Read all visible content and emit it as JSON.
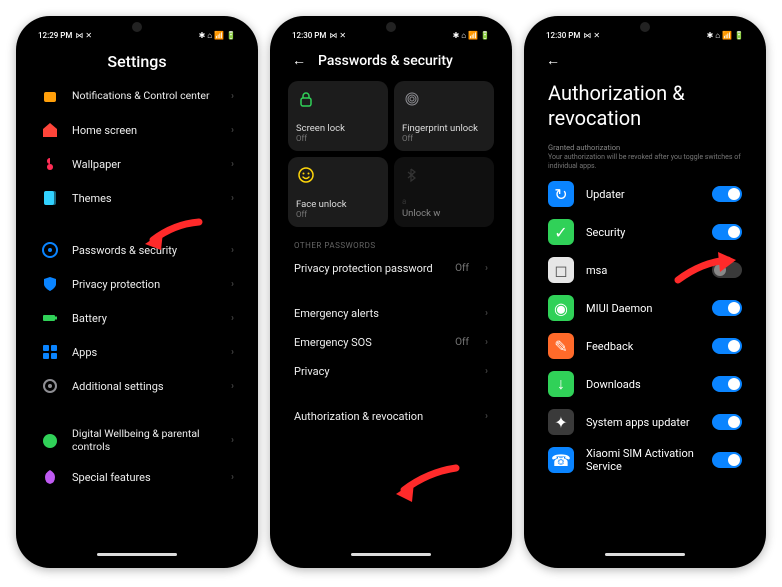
{
  "colors": {
    "accent_blue": "#0a84ff",
    "arrow_red": "#ff2a2a",
    "tile_bg": "#1c1c1c"
  },
  "screen1": {
    "status": {
      "time": "12:29 PM",
      "left_icons": "⋈ ✕",
      "right_icons": "✱ ⌂ 📶 🔋"
    },
    "title": "Settings",
    "items": [
      {
        "icon": "notifications-icon",
        "label": "Notifications & Control center",
        "color": "#ff9f0a"
      },
      {
        "icon": "home-icon",
        "label": "Home screen",
        "color": "#ff453a"
      },
      {
        "icon": "wallpaper-icon",
        "label": "Wallpaper",
        "color": "#ff2d55"
      },
      {
        "icon": "themes-icon",
        "label": "Themes",
        "color": "#32d2ff"
      }
    ],
    "items2": [
      {
        "icon": "lock-icon",
        "label": "Passwords & security",
        "color": "#0a84ff"
      },
      {
        "icon": "shield-icon",
        "label": "Privacy protection",
        "color": "#0a84ff"
      },
      {
        "icon": "battery-icon",
        "label": "Battery",
        "color": "#30d158"
      },
      {
        "icon": "apps-icon",
        "label": "Apps",
        "color": "#0a84ff"
      },
      {
        "icon": "gear-icon",
        "label": "Additional settings",
        "color": "#8e8e93"
      }
    ],
    "items3": [
      {
        "icon": "wellbeing-icon",
        "label": "Digital Wellbeing & parental controls",
        "color": "#30d158"
      },
      {
        "icon": "special-icon",
        "label": "Special features",
        "color": "#bf5af2"
      }
    ]
  },
  "screen2": {
    "status": {
      "time": "12:30 PM",
      "left_icons": "⋈ ✕",
      "right_icons": "✱ ⌂ 📶 🔋"
    },
    "title": "Passwords & security",
    "tiles": [
      {
        "icon": "padlock-icon",
        "title": "Screen lock",
        "sub": "Off",
        "color": "#30d158"
      },
      {
        "icon": "fingerprint-icon",
        "title": "Fingerprint unlock",
        "sub": "Off",
        "color": "#8e8e93",
        "dim": false
      },
      {
        "icon": "face-icon",
        "title": "Face unlock",
        "sub": "Off",
        "color": "#ffd60a"
      },
      {
        "icon": "bluetooth-icon",
        "title": "Unlock w",
        "sub": "",
        "color": "#555",
        "dim": true,
        "extra": "a"
      }
    ],
    "other_header": "OTHER PASSWORDS",
    "rows": [
      {
        "label": "Privacy protection password",
        "value": "Off"
      }
    ],
    "rows2": [
      {
        "label": "Emergency alerts"
      },
      {
        "label": "Emergency SOS",
        "value": "Off"
      },
      {
        "label": "Privacy"
      }
    ],
    "rows3": [
      {
        "label": "Authorization & revocation"
      }
    ]
  },
  "screen3": {
    "status": {
      "time": "12:30 PM",
      "left_icons": "⋈ ✕",
      "right_icons": "✱ ⌂ 📶 🔋"
    },
    "title": "Authorization & revocation",
    "granted_header": "Granted authorization",
    "granted_desc": "Your authorization will be revoked after you toggle switches of individual apps.",
    "apps": [
      {
        "icon_bg": "#0a84ff",
        "glyph": "↻",
        "label": "Updater",
        "on": true
      },
      {
        "icon_bg": "#30d158",
        "glyph": "✓",
        "label": "Security",
        "on": true
      },
      {
        "icon_bg": "#e6e6e6",
        "glyph": "◻",
        "label": "msa",
        "on": false
      },
      {
        "icon_bg": "#30d158",
        "glyph": "◉",
        "label": "MIUI Daemon",
        "on": true
      },
      {
        "icon_bg": "#ff6a2a",
        "glyph": "✎",
        "label": "Feedback",
        "on": true
      },
      {
        "icon_bg": "#30d158",
        "glyph": "↓",
        "label": "Downloads",
        "on": true
      },
      {
        "icon_bg": "#3a3a3a",
        "glyph": "✦",
        "label": "System apps updater",
        "on": true
      },
      {
        "icon_bg": "#0a84ff",
        "glyph": "☎",
        "label": "Xiaomi SIM Activation Service",
        "on": true
      }
    ]
  }
}
